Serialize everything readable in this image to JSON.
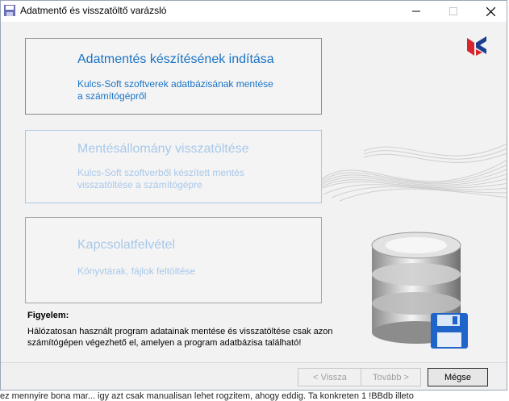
{
  "window": {
    "title": "Adatmentő és visszatöltő varázsló"
  },
  "cards": [
    {
      "title": "Adatmentés készítésének indítása",
      "desc": "Kulcs-Soft szoftverek adatbázisának mentése\na számítógépről"
    },
    {
      "title": "Mentésállomány visszatöltése",
      "desc": "Kulcs-Soft szoftverből készített mentés\nvisszatöltése a számítógépre"
    },
    {
      "title": "Kapcsolatfelvétel",
      "desc": "Könyvtárak, fájlok feltöltése"
    }
  ],
  "warning": {
    "title": "Figyelem:",
    "text": "Hálózatosan használt program adatainak mentése és visszatöltése csak azon\nszámítógépen végezhető el, amelyen a program adatbázisa található!"
  },
  "buttons": {
    "back": "< Vissza",
    "next": "Tovább >",
    "cancel": "Mégse"
  },
  "background_text": "ez mennyire bona mar... igy azt csak manualisan lehet rogzitem, ahogy eddig. Ta konkreten 1 !BBdb illeto",
  "colors": {
    "active_link": "#1a73c4",
    "disabled_link": "#a8c8ea",
    "logo_red": "#d9262e",
    "logo_blue": "#1c3f8f"
  }
}
